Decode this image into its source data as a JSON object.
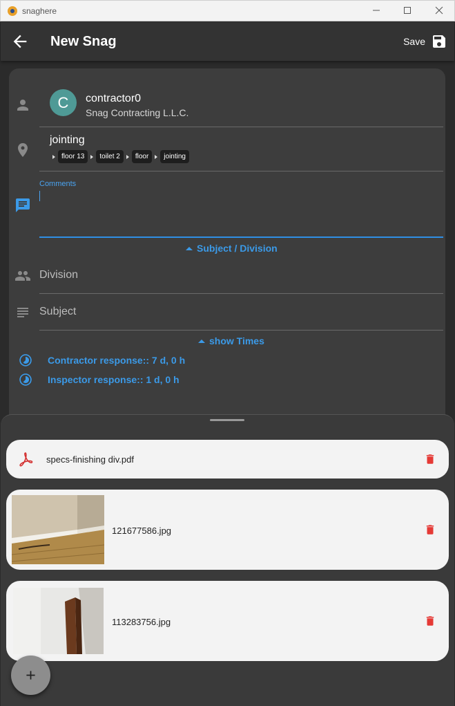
{
  "window": {
    "title": "snaghere",
    "controls": [
      "minimize",
      "maximize",
      "close"
    ]
  },
  "appbar": {
    "title": "New Snag",
    "save_label": "Save"
  },
  "contractor": {
    "avatar_letter": "C",
    "name": "contractor0",
    "company": "Snag Contracting L.L.C."
  },
  "location": {
    "name": "jointing",
    "breadcrumbs": [
      "floor 13",
      "toilet 2",
      "floor",
      "jointing"
    ]
  },
  "comments": {
    "label": "Comments",
    "value": ""
  },
  "subject_division": {
    "toggle_label": "Subject / Division",
    "division_placeholder": "Division",
    "subject_placeholder": "Subject"
  },
  "times": {
    "toggle_label": "show Times",
    "contractor_response": "Contractor response:: 7 d, 0 h",
    "inspector_response": "Inspector response:: 1 d, 0 h"
  },
  "attachments": [
    {
      "type": "pdf",
      "name": "specs-finishing div.pdf"
    },
    {
      "type": "image",
      "name": "121677586.jpg"
    },
    {
      "type": "image",
      "name": "113283756.jpg"
    }
  ],
  "colors": {
    "accent": "#3b9ae8",
    "delete": "#e53935",
    "pdf": "#d32f2f",
    "avatar": "#4f9a96"
  },
  "fab": {
    "icon": "plus-icon"
  }
}
